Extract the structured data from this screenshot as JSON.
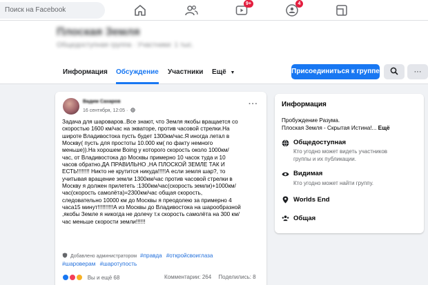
{
  "topbar": {
    "search_placeholder": "Поиск на Facebook",
    "watch_badge": "9+",
    "groups_badge": "4"
  },
  "group": {
    "title": "Плоская Земля",
    "subtitle": "Общедоступная группа · Участники: 1 тыс.",
    "tabs": [
      "Информация",
      "Обсуждение",
      "Участники",
      "Ещё"
    ],
    "join_label": "Присоединиться к группе",
    "more_label": "···"
  },
  "post": {
    "author": "Вадим Сахаров",
    "date": "16 сентября, 12:05 ·",
    "menu": "···",
    "lines": [
      "Задача для шароваров..Все знают, что Земля якобы вращается со",
      "скоростью 1600 км/час на экваторе, против часовой стрелки.На",
      "широте Владивостока пусть будет 1300км/час.Я иногда летал в",
      "Москву( пусть для простоты 10.000 км( по факту немного",
      "меньше)).На хорошем Boing у которого скорость около 1000км/",
      "час, от Владивостока до Москвы примерно 10 часок туда и 10",
      "часов обратно.ДА ПРАВИЛЬНО ,НА ПЛОСКОЙ ЗЕМЛЕ ТАК И",
      "ЕСТЬ!!!!!!!! Никто не крутится никуда!!!!!А если земля шар?, то",
      "учитывая вращение земли 1300км/час против часовой стрелки в",
      "Москву я должен прилететь :1300км/час(скорость земли)+1000км/",
      "час(скорость самолёта)=2300км/час общая скорость,",
      "следовательно 10000 км до Москвы я преодолею за примерно 4",
      "часа15 минут!!!!!!!!!!А из Москвы до Владивостока на шарообразной",
      ",якобы Земле я никогда не долечу т.к скорость самолёта на 300 км/",
      "час меньше скорости земли!!!!!!"
    ],
    "admin_note": "Добавлено администратором",
    "hashtags": [
      "#правда",
      "#откройсвоиглаза",
      "#шароверам",
      "#шаротупость"
    ],
    "reactions_text": "Вы и ещё 68",
    "comments": "Комментарии: 264",
    "shares": "Поделились: 8"
  },
  "info": {
    "title": "Информация",
    "desc_line1": "Пробуждение Разума.",
    "desc_line2": "Плоская Земля - Скрытая Истина!...",
    "more": "Ещё",
    "rows": [
      {
        "icon": "globe-icon",
        "title": "Общедоступная",
        "desc1": "Кто угодно может видеть участников",
        "desc2": "группы и их публикации."
      },
      {
        "icon": "eye-icon",
        "title": "Видимая",
        "desc1": "Кто угодно может найти группу.",
        "desc2": ""
      },
      {
        "icon": "location-pin-icon",
        "title": "Worlds End",
        "desc1": "",
        "desc2": ""
      },
      {
        "icon": "people-icon",
        "title": "Общая",
        "desc1": "",
        "desc2": ""
      }
    ]
  },
  "colors": {
    "accent": "#1877f2",
    "badge": "#e41e3f",
    "hashtag": "#216fdb",
    "like": "#1877f2",
    "love": "#f33e58",
    "haha": "#f7b125"
  }
}
